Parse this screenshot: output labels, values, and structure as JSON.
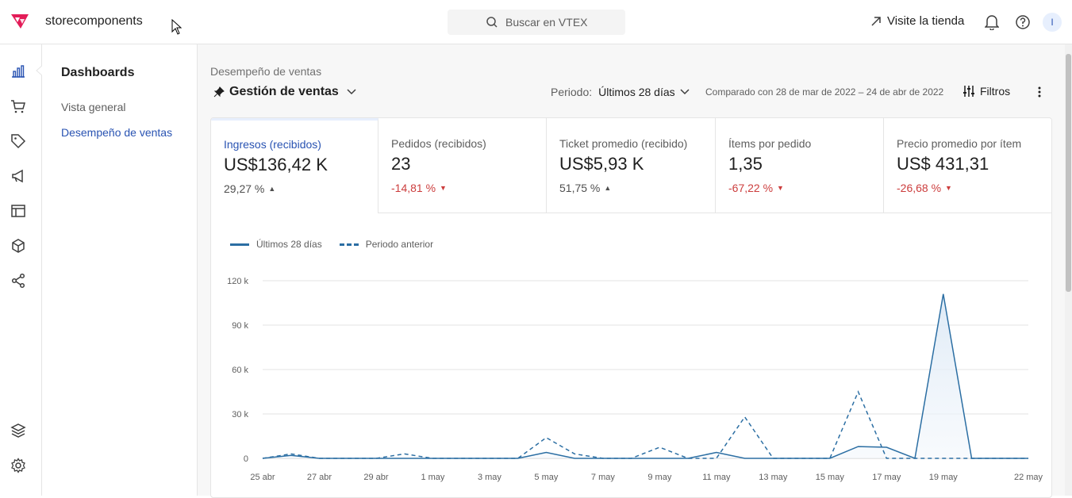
{
  "header": {
    "account": "storecomponents",
    "search_placeholder": "Buscar en VTEX",
    "visit_store": "Visite la tienda",
    "avatar_initial": "I"
  },
  "sidebar": {
    "title": "Dashboards",
    "items": [
      {
        "label": "Vista general",
        "active": false
      },
      {
        "label": "Desempeño de ventas",
        "active": true
      }
    ]
  },
  "page": {
    "breadcrumb": "Desempeño de ventas",
    "title": "Gestión de ventas",
    "period_label": "Periodo:",
    "period_value": "Últimos 28 días",
    "compared": "Comparado con 28 de mar de 2022 – 24 de abr de 2022",
    "filters_label": "Filtros"
  },
  "kpis": [
    {
      "label": "Ingresos (recibidos)",
      "value": "US$136,42 K",
      "change": "29,27 %",
      "trend": "up",
      "arrow": "▲",
      "active": true
    },
    {
      "label": "Pedidos (recibidos)",
      "value": "23",
      "change": "-14,81 %",
      "trend": "down",
      "arrow": "▼",
      "active": false
    },
    {
      "label": "Ticket promedio (recibido)",
      "value": "US$5,93 K",
      "change": "51,75 %",
      "trend": "up",
      "arrow": "▲",
      "active": false
    },
    {
      "label": "Ítems por pedido",
      "value": "1,35",
      "change": "-67,22 %",
      "trend": "down",
      "arrow": "▼",
      "active": false
    },
    {
      "label": "Precio promedio por ítem",
      "value": "US$ 431,31",
      "change": "-26,68 %",
      "trend": "down",
      "arrow": "▼",
      "active": false
    }
  ],
  "colors": {
    "accent": "#2953b2",
    "line": "#2b6ea3",
    "negative": "#cc3d3d"
  },
  "chart_data": {
    "type": "line",
    "legend": [
      "Últimos 28 días",
      "Periodo anterior"
    ],
    "x_ticks": [
      "25 abr",
      "27 abr",
      "29 abr",
      "1 may",
      "3 may",
      "5 may",
      "7 may",
      "9 may",
      "11 may",
      "13 may",
      "15 may",
      "17 may",
      "19 may",
      "22 may"
    ],
    "y_ticks": [
      "0",
      "30 k",
      "60 k",
      "90 k",
      "120 k"
    ],
    "ylim": [
      0,
      120000
    ],
    "x_count": 28,
    "series": [
      {
        "name": "Últimos 28 días",
        "style": "solid",
        "values": [
          0,
          2000,
          0,
          0,
          0,
          0,
          0,
          0,
          0,
          0,
          4000,
          0,
          0,
          0,
          0,
          0,
          4000,
          0,
          0,
          0,
          0,
          8000,
          7500,
          0,
          111000,
          0,
          0,
          0
        ]
      },
      {
        "name": "Periodo anterior",
        "style": "dashed",
        "values": [
          0,
          3000,
          0,
          0,
          0,
          3000,
          0,
          0,
          0,
          0,
          14000,
          3000,
          0,
          0,
          7500,
          0,
          0,
          28000,
          0,
          0,
          0,
          45000,
          0,
          0,
          0,
          0,
          0,
          0
        ]
      }
    ]
  }
}
